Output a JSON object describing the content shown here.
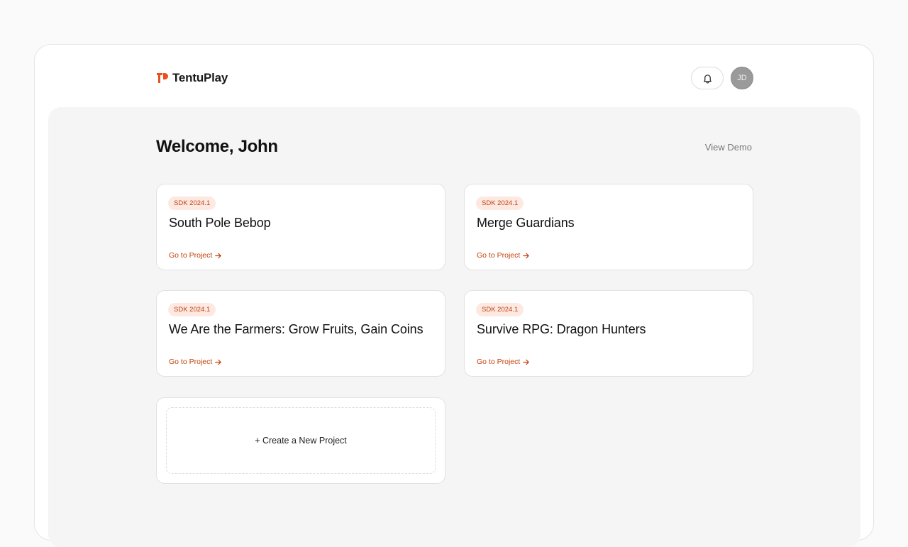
{
  "brand": {
    "name": "TentuPlay",
    "accent_color": "#E8501E"
  },
  "header": {
    "notification_icon": "bell-icon",
    "avatar_initials": "JD"
  },
  "page": {
    "welcome": "Welcome, John",
    "view_demo": "View Demo"
  },
  "projects": [
    {
      "badge": "SDK 2024.1",
      "title": "South Pole Bebop",
      "link": "Go to Project"
    },
    {
      "badge": "SDK 2024.1",
      "title": "Merge Guardians",
      "link": "Go to Project"
    },
    {
      "badge": "SDK 2024.1",
      "title": "We Are the Farmers: Grow Fruits, Gain Coins",
      "link": "Go to Project"
    },
    {
      "badge": "SDK 2024.1",
      "title": "Survive RPG: Dragon Hunters",
      "link": "Go to Project"
    }
  ],
  "create_project": "+ Create a New Project"
}
